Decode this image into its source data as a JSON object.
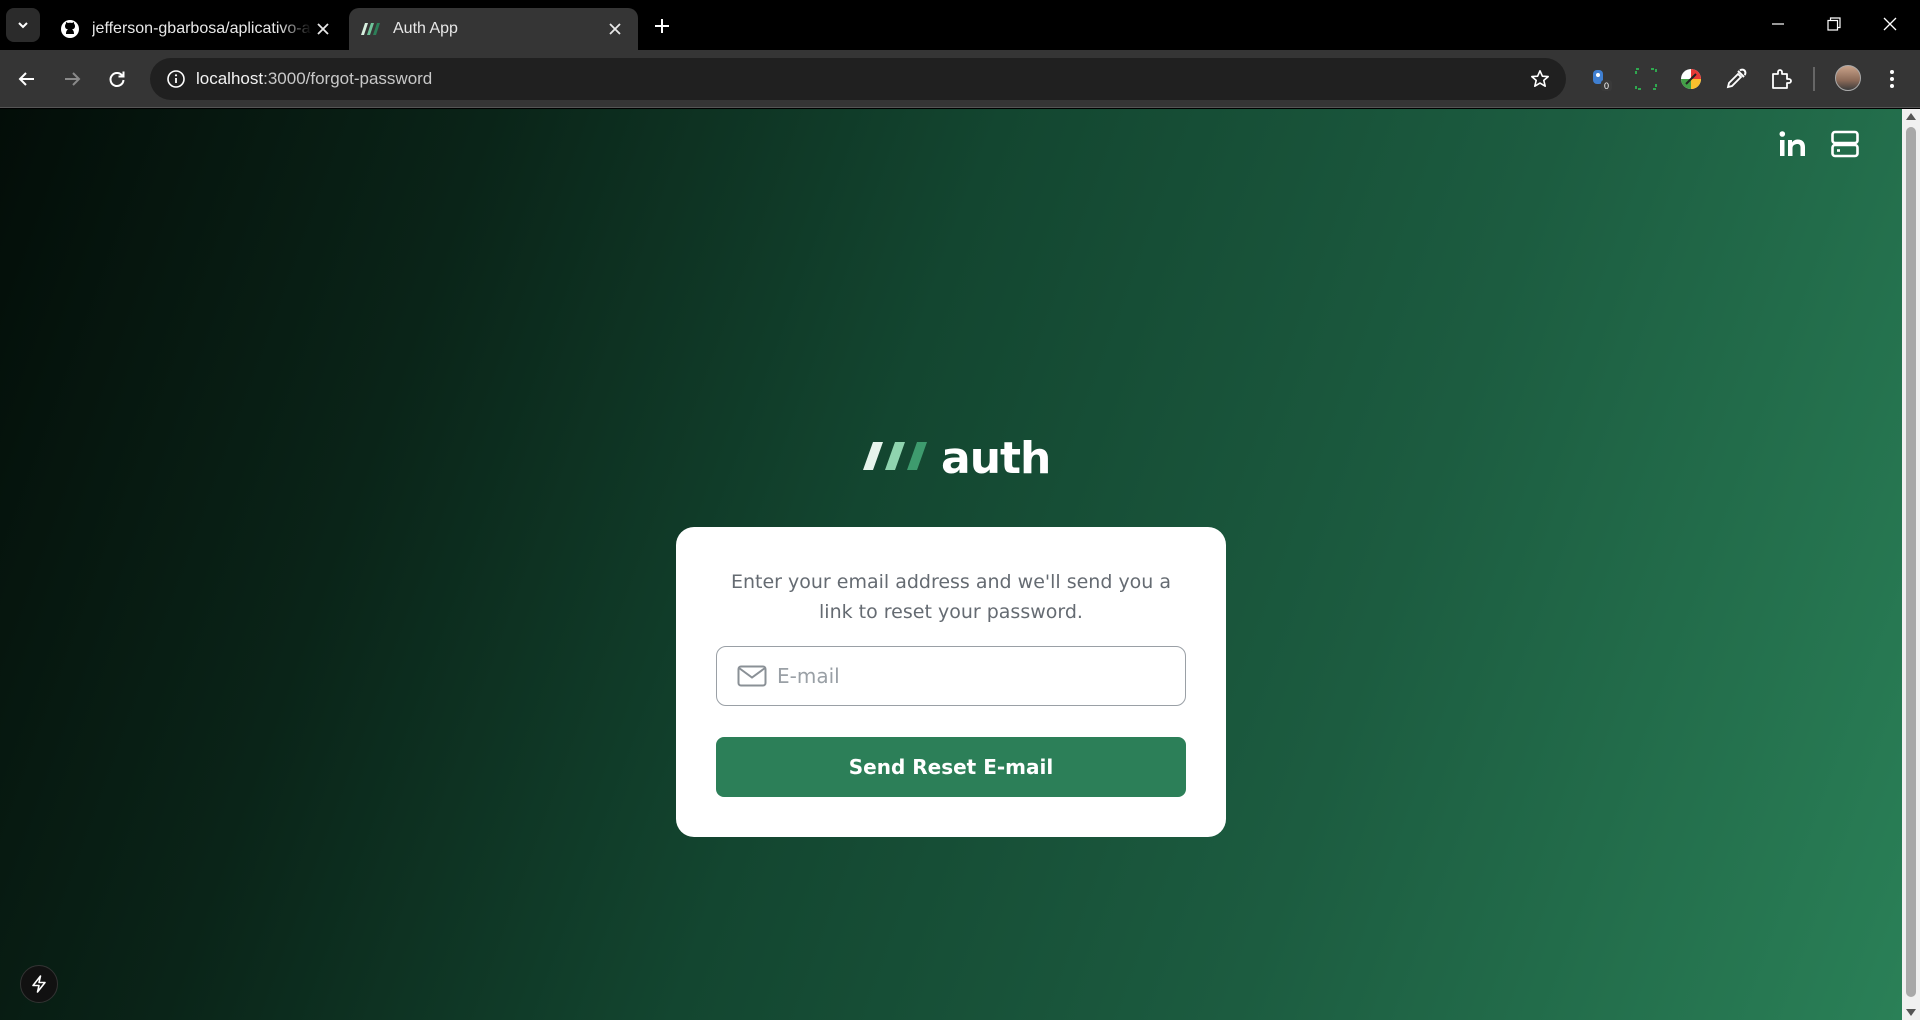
{
  "browser": {
    "tabs": [
      {
        "title": "jefferson-gbarbosa/aplicativo-a",
        "icon": "github-icon",
        "active": false
      },
      {
        "title": "Auth App",
        "icon": "auth-logo-icon",
        "active": true
      }
    ],
    "address": {
      "host": "localhost",
      "path": ":3000/forgot-password"
    },
    "extensions": [
      {
        "name": "extension-badge-icon",
        "badge": "0"
      },
      {
        "name": "screen-capture-icon"
      },
      {
        "name": "color-wheel-icon"
      },
      {
        "name": "eyedropper-icon"
      },
      {
        "name": "puzzle-icon"
      }
    ]
  },
  "page": {
    "brand": "auth",
    "card": {
      "description": "Enter your email address and we'll send you a link to reset your password.",
      "email_placeholder": "E-mail",
      "email_value": "",
      "submit_label": "Send Reset E-mail"
    },
    "top_icons": [
      "linkedin-icon",
      "server-icon"
    ]
  },
  "colors": {
    "accent": "#2c7f58",
    "card_bg": "#ffffff",
    "gradient_dark": "#030d08",
    "gradient_light": "#2a8057"
  }
}
